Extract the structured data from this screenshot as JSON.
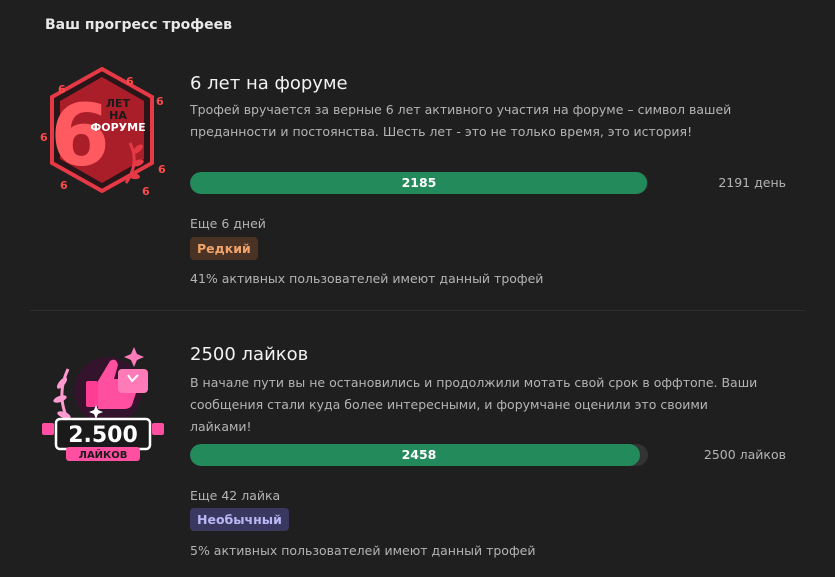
{
  "section_title": "Ваш прогресс трофеев",
  "trophies": [
    {
      "name": "6 лет на форуме",
      "description": "Трофей вручается за верные 6 лет активного участия на форуме – символ вашей преданности и постоянства. Шесть лет - это не только время, это история!",
      "progress_value": "2185",
      "progress_fraction": 0.997,
      "target": "2191 день",
      "remaining": "Еще 6 дней",
      "rarity": "Редкий",
      "stat": "41% активных пользователей имеют данный трофей",
      "icon": "six-years-badge-icon",
      "art_text": {
        "big": "6",
        "line1": "ЛЕТ",
        "line2": "НА",
        "line3": "ФОРУМЕ",
        "small": "6"
      },
      "colors": {
        "accent": "#e63946",
        "rarity_bg": "#4a3325",
        "rarity_fg": "#f0a36a"
      }
    },
    {
      "name": "2500 лайков",
      "description": "В начале пути вы не остановились и продолжили мотать свой срок в оффтопе. Ваши сообщения стали куда более интересными, и форумчане оценили это своими лайками!",
      "progress_value": "2458",
      "progress_fraction": 0.983,
      "target": "2500 лайков",
      "remaining": "Еще 42 лайка",
      "rarity": "Необычный",
      "stat": "5% активных пользователей имеют данный трофей",
      "icon": "likes-2500-badge-icon",
      "art_text": {
        "big": "2.500",
        "label": "ЛАЙКОВ"
      },
      "colors": {
        "accent": "#ff4fa0",
        "rarity_bg": "#3a3860",
        "rarity_fg": "#b9b6f4"
      }
    }
  ],
  "colors": {
    "background": "#1f1f1f",
    "bar_fill": "#238a5b",
    "bar_track": "#333333"
  }
}
